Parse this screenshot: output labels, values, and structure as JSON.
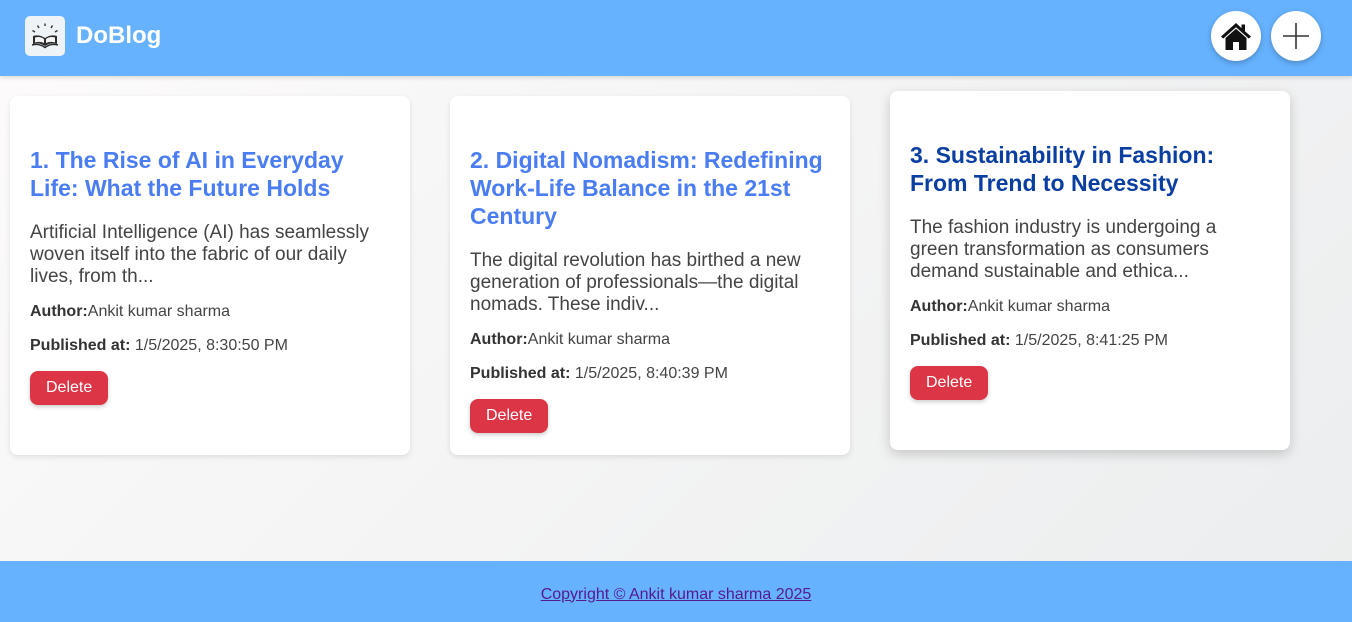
{
  "header": {
    "brand": "DoBlog",
    "logo_icon": "open-book-logo-icon",
    "home_icon": "home-icon",
    "add_icon": "plus-icon"
  },
  "posts": [
    {
      "title": "1. The Rise of AI in Everyday Life: What the Future Holds",
      "excerpt": "Artificial Intelligence (AI) has seamlessly woven itself into the fabric of our daily lives, from th...",
      "author_label": "Author:",
      "author": "Ankit kumar sharma",
      "published_label": "Published at:",
      "published": "1/5/2025, 8:30:50 PM",
      "delete_label": "Delete"
    },
    {
      "title": "2. Digital Nomadism: Redefining Work-Life Balance in the 21st Century",
      "excerpt": "The digital revolution has birthed a new generation of professionals—the digital nomads. These indiv...",
      "author_label": "Author:",
      "author": "Ankit kumar sharma",
      "published_label": "Published at:",
      "published": "1/5/2025, 8:40:39 PM",
      "delete_label": "Delete"
    },
    {
      "title": "3. Sustainability in Fashion: From Trend to Necessity",
      "excerpt": "The fashion industry is undergoing a green transformation as consumers demand sustainable and ethica...",
      "author_label": "Author:",
      "author": "Ankit kumar sharma",
      "published_label": "Published at:",
      "published": "1/5/2025, 8:41:25 PM",
      "delete_label": "Delete"
    }
  ],
  "footer": {
    "copyright": "Copyright © Ankit kumar sharma 2025"
  },
  "colors": {
    "header_bg": "#66b2ff",
    "title_blue": "#4a7cf2",
    "title_hover": "#0a3ea0",
    "delete_red": "#dc3545"
  }
}
